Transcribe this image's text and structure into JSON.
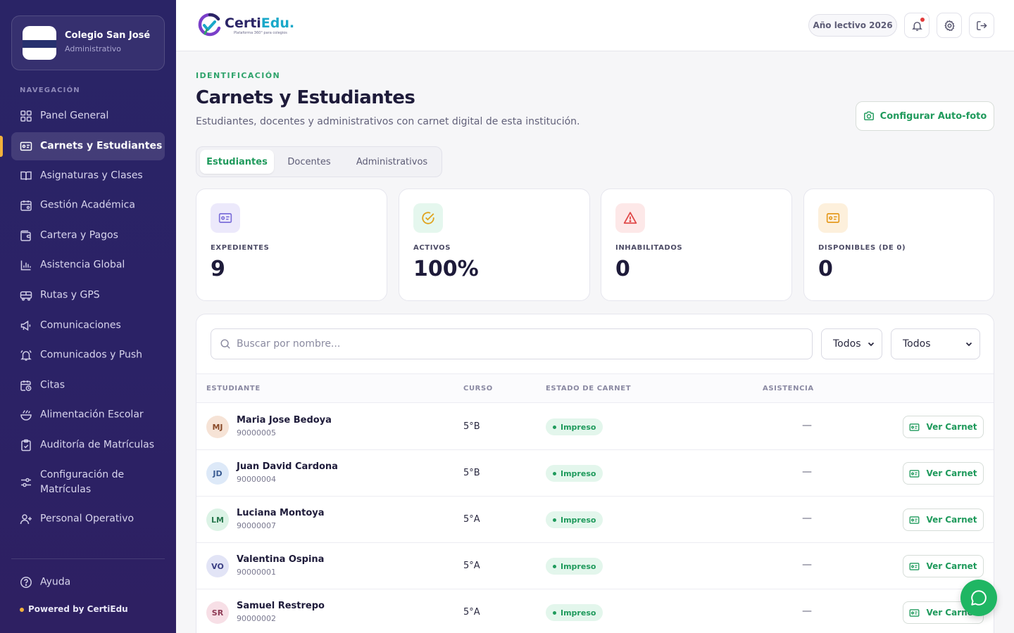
{
  "sidebar": {
    "school_name": "Colegio San José",
    "school_role": "Administrativo",
    "nav_heading": "NAVEGACIÓN",
    "items": [
      {
        "label": "Panel General",
        "icon": "grid-icon"
      },
      {
        "label": "Carnets y Estudiantes",
        "icon": "id-card-icon",
        "active": true
      },
      {
        "label": "Asignaturas y Clases",
        "icon": "book-icon"
      },
      {
        "label": "Gestión Académica",
        "icon": "calendar-icon"
      },
      {
        "label": "Cartera y Pagos",
        "icon": "wallet-icon"
      },
      {
        "label": "Asistencia Global",
        "icon": "bar-chart-icon"
      },
      {
        "label": "Rutas y GPS",
        "icon": "bus-icon"
      },
      {
        "label": "Comunicaciones",
        "icon": "megaphone-icon"
      },
      {
        "label": "Comunicados y Push",
        "icon": "bell-ring-icon"
      },
      {
        "label": "Citas",
        "icon": "calendar-clock-icon"
      },
      {
        "label": "Alimentación Escolar",
        "icon": "bowl-icon"
      },
      {
        "label": "Auditoría de Matrículas",
        "icon": "clipboard-check-icon"
      },
      {
        "label": "Configuración de Matrículas",
        "icon": "sliders-icon"
      },
      {
        "label": "Personal Operativo",
        "icon": "user-plus-icon"
      }
    ],
    "help_label": "Ayuda",
    "powered_by": "Powered by CertiEdu"
  },
  "header": {
    "brand": {
      "name_main": "Certi",
      "name_accent": "Edu.",
      "tagline": "Plataforma 360° para colegios"
    },
    "school_year": "Año lectivo 2026"
  },
  "page": {
    "eyebrow": "IDENTIFICACIÓN",
    "title": "Carnets y Estudiantes",
    "subtitle": "Estudiantes, docentes y administrativos con carnet digital de esta institución.",
    "autofoto_label": "Configurar Auto-foto"
  },
  "tabs": [
    {
      "label": "Estudiantes",
      "active": true
    },
    {
      "label": "Docentes",
      "active": false
    },
    {
      "label": "Administrativos",
      "active": false
    }
  ],
  "stats": [
    {
      "label": "EXPEDIENTES",
      "value": "9",
      "icon": "id-card-icon",
      "color": "#7c6fd9",
      "bg": "#ece9fb"
    },
    {
      "label": "ACTIVOS",
      "value": "100%",
      "icon": "check-circle-icon",
      "color": "#e0a21c",
      "bg": "#e5f7ee"
    },
    {
      "label": "INHABILITADOS",
      "value": "0",
      "icon": "alert-triangle-icon",
      "color": "#e04848",
      "bg": "#fde8e8"
    },
    {
      "label": "DISPONIBLES (DE 0)",
      "value": "0",
      "icon": "id-card-icon",
      "color": "#e59a1e",
      "bg": "#fdf0dc"
    }
  ],
  "filters": {
    "search_placeholder": "Buscar por nombre...",
    "select_1": "Todos",
    "select_2": "Todos"
  },
  "table": {
    "headers": {
      "student": "ESTUDIANTE",
      "course": "CURSO",
      "status": "ESTADO DE CARNET",
      "attendance": "ASISTENCIA"
    },
    "rows": [
      {
        "initials": "MJ",
        "name": "Maria Jose Bedoya",
        "id": "90000005",
        "course": "5°B",
        "status": "Impreso",
        "attendance": "—",
        "action": "Ver Carnet",
        "avatar_bg": "#f6e3d6",
        "avatar_fg": "#8a4b2a"
      },
      {
        "initials": "JD",
        "name": "Juan David Cardona",
        "id": "90000004",
        "course": "5°B",
        "status": "Impreso",
        "attendance": "—",
        "action": "Ver Carnet",
        "avatar_bg": "#dde9f8",
        "avatar_fg": "#3a5c93"
      },
      {
        "initials": "LM",
        "name": "Luciana Montoya",
        "id": "90000007",
        "course": "5°A",
        "status": "Impreso",
        "attendance": "—",
        "action": "Ver Carnet",
        "avatar_bg": "#dcf3e6",
        "avatar_fg": "#2a7a50"
      },
      {
        "initials": "VO",
        "name": "Valentina Ospina",
        "id": "90000001",
        "course": "5°A",
        "status": "Impreso",
        "attendance": "—",
        "action": "Ver Carnet",
        "avatar_bg": "#e2e4f6",
        "avatar_fg": "#3b3f84"
      },
      {
        "initials": "SR",
        "name": "Samuel Restrepo",
        "id": "90000002",
        "course": "5°A",
        "status": "Impreso",
        "attendance": "—",
        "action": "Ver Carnet",
        "avatar_bg": "#f7dfe6",
        "avatar_fg": "#8e3a55"
      }
    ]
  },
  "colors": {
    "sidebar": "#2a2466",
    "accent_green": "#1f9a5c",
    "active_marker": "#f2b13c"
  }
}
